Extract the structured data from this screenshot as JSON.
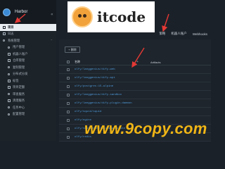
{
  "app": {
    "title": "Harbor"
  },
  "sidebar": {
    "collapse_icon": "«",
    "items": [
      {
        "label": "项目",
        "icon": "project-icon",
        "level": "top",
        "active": true
      },
      {
        "label": "日志",
        "icon": "log-icon",
        "level": "top",
        "active": false
      },
      {
        "label": "系统管理",
        "icon": "system-icon",
        "level": "top",
        "active": false,
        "chevron": "⌃"
      },
      {
        "label": "用户管理",
        "icon": "user-icon",
        "level": "sub"
      },
      {
        "label": "机器人账户",
        "icon": "robot-icon",
        "level": "sub"
      },
      {
        "label": "仓库管理",
        "icon": "registry-icon",
        "level": "sub"
      },
      {
        "label": "复制管理",
        "icon": "replication-icon",
        "level": "sub"
      },
      {
        "label": "分布式分发",
        "icon": "distribution-icon",
        "level": "sub"
      },
      {
        "label": "标签",
        "icon": "label-icon",
        "level": "sub"
      },
      {
        "label": "项目定额",
        "icon": "quota-icon",
        "level": "sub"
      },
      {
        "label": "审查服务",
        "icon": "interrogation-icon",
        "level": "sub"
      },
      {
        "label": "清理服务",
        "icon": "clean-icon",
        "level": "sub"
      },
      {
        "label": "任务中心",
        "icon": "job-icon",
        "level": "sub"
      },
      {
        "label": "配置管理",
        "icon": "config-icon",
        "level": "sub"
      }
    ]
  },
  "logo": {
    "text": "itcode"
  },
  "tabs": [
    {
      "label": "策略"
    },
    {
      "label": "机器人账户"
    },
    {
      "label": "Webhooks"
    }
  ],
  "main": {
    "new_button": "+ 删除",
    "header": {
      "name": "名称",
      "plus": "+",
      "artifacts": "Artifacts"
    },
    "rows": [
      {
        "name": "olfy/langgenius/dify-web"
      },
      {
        "name": "olfy/langgenius/dify-api"
      },
      {
        "name": "olfy/postgres:15-alpine"
      },
      {
        "name": "olfy/langgenius/dify-sandbox"
      },
      {
        "name": "olfy/langgenius/dify-plugin-daemon"
      },
      {
        "name": "olfy/squid/squid"
      },
      {
        "name": "olfy/nginx"
      },
      {
        "name": "olfy/semitechnologies/weaviate"
      },
      {
        "name": "olfy/redis"
      }
    ]
  },
  "watermark": {
    "text": "www.9copy.com"
  },
  "colors": {
    "accent": "#4f9bdc",
    "active_bg": "#e8edf2",
    "arrow": "#e53935",
    "watermark": "#f0b516"
  }
}
